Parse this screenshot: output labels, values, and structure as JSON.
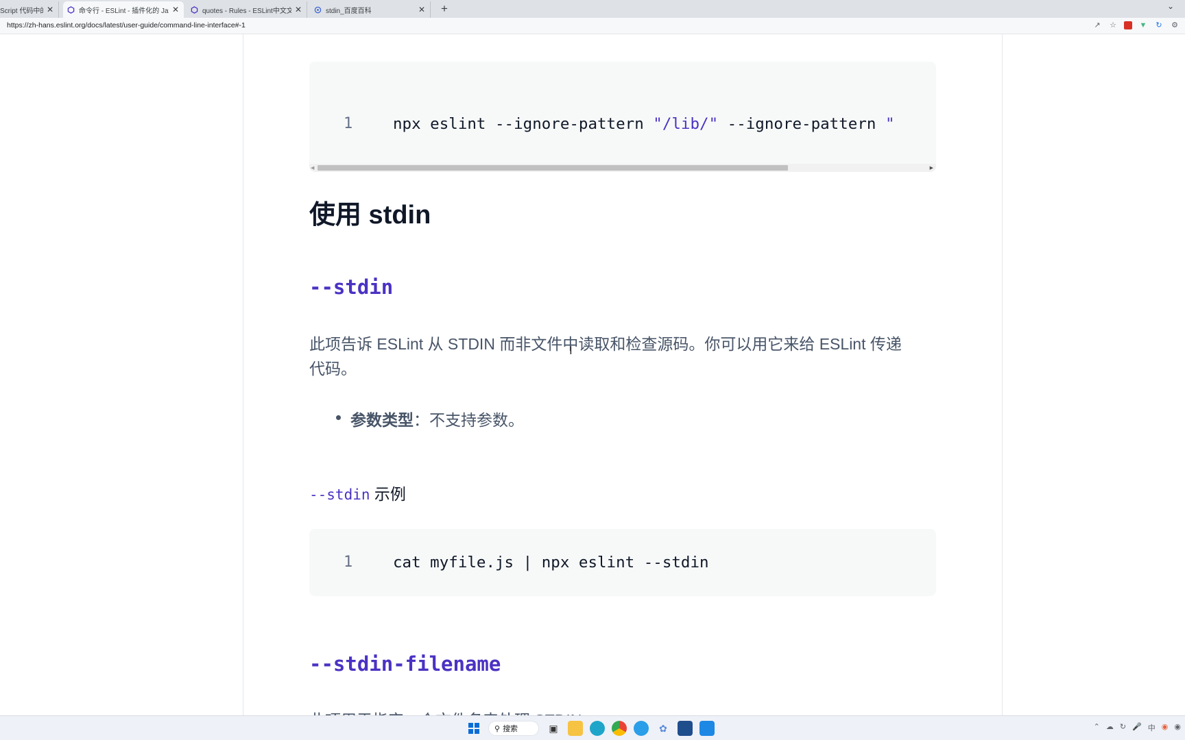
{
  "browser": {
    "tabs": [
      {
        "title": "Script 代码中的",
        "active": false
      },
      {
        "title": "命令行 - ESLint - 插件化的 JavaS",
        "active": true
      },
      {
        "title": "quotes - Rules - ESLint中文文档",
        "active": false
      },
      {
        "title": "stdin_百度百科",
        "active": false
      }
    ],
    "new_tab": "+",
    "close_glyph": "✕",
    "url": "https://zh-hans.eslint.org/docs/latest/user-guide/command-line-interface#-1"
  },
  "content": {
    "code1": {
      "line_number": "1",
      "cmd": "npx eslint --ignore-pattern ",
      "str1": "\"/lib/\"",
      "cmd2": " --ignore-pattern ",
      "str2": "\""
    },
    "heading_stdin_section": "使用 stdin",
    "heading_stdin": "--stdin",
    "para_stdin_line1": "此项告诉 ESLint 从 STDIN 而非文件中读取和检查源码。你可以用它来给 ESLint 传递",
    "para_stdin_line2": "代码。",
    "bullet_label": "参数类型",
    "bullet_text": "：不支持参数。",
    "example_heading_code": "--stdin",
    "example_heading_text": " 示例",
    "code2": {
      "line_number": "1",
      "text": "cat myfile.js | npx eslint --stdin"
    },
    "heading_stdin_filename": "--stdin-filename",
    "cut_text": "此项用于指定一个文件名来处理 STDIN。"
  },
  "taskbar": {
    "search_label": "搜索"
  },
  "colors": {
    "accent": "#4b32c3",
    "text": "#475467",
    "heading": "#101828",
    "code_bg": "#f7f9f9"
  }
}
